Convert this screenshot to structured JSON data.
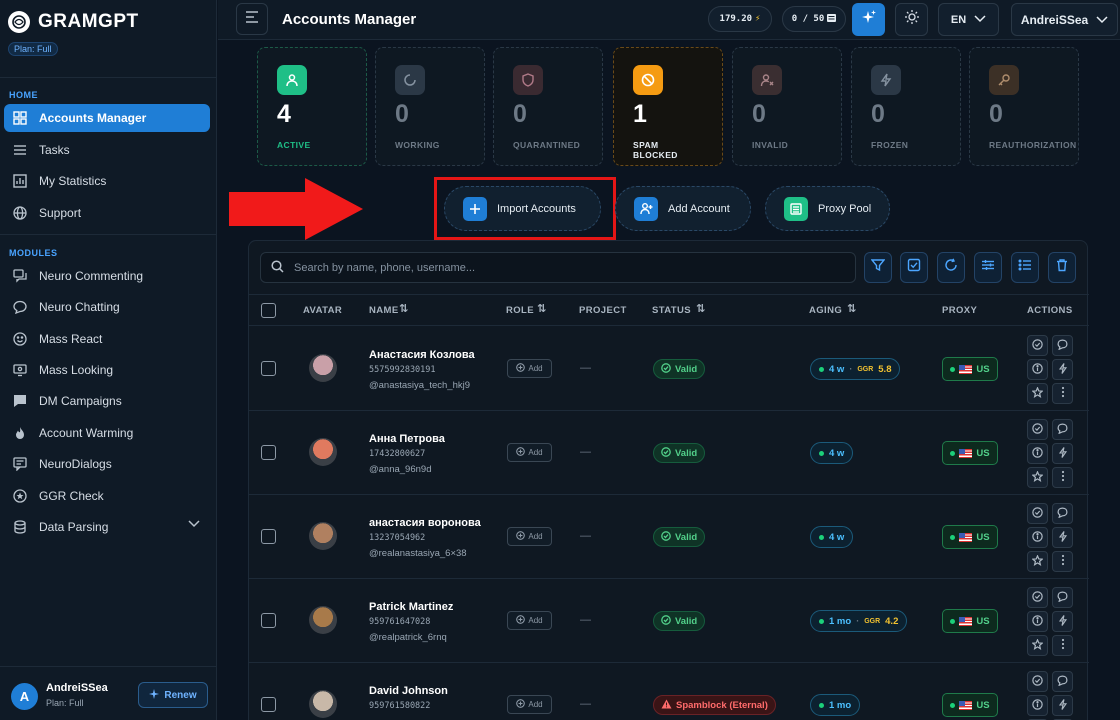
{
  "app": {
    "name": "GRAMGPT",
    "plan_badge": "Plan: Full"
  },
  "sidebar": {
    "sections": [
      {
        "label": "HOME",
        "items": [
          {
            "label": "Accounts Manager",
            "icon": "grid-icon",
            "active": true
          },
          {
            "label": "Tasks",
            "icon": "list-icon"
          },
          {
            "label": "My Statistics",
            "icon": "chart-icon"
          },
          {
            "label": "Support",
            "icon": "globe-icon"
          }
        ]
      },
      {
        "label": "MODULES",
        "items": [
          {
            "label": "Neuro Commenting",
            "icon": "comments-icon"
          },
          {
            "label": "Neuro Chatting",
            "icon": "chat-icon"
          },
          {
            "label": "Mass React",
            "icon": "smile-icon"
          },
          {
            "label": "Mass Looking",
            "icon": "monitor-icon"
          },
          {
            "label": "DM Campaigns",
            "icon": "message-icon"
          },
          {
            "label": "Account Warming",
            "icon": "flame-icon"
          },
          {
            "label": "NeuroDialogs",
            "icon": "dialogs-icon"
          },
          {
            "label": "GGR Check",
            "icon": "star-badge-icon"
          },
          {
            "label": "Data Parsing",
            "icon": "database-icon",
            "expandable": true
          }
        ]
      }
    ],
    "user": {
      "initial": "A",
      "name": "AndreiSSea",
      "plan": "Plan: Full",
      "renew_label": "Renew"
    }
  },
  "header": {
    "title": "Accounts Manager",
    "balance": "179.20",
    "quota": "0 / 50",
    "language": "EN",
    "username": "AndreiSSea"
  },
  "stats": [
    {
      "value": "4",
      "label": "ACTIVE",
      "icon": "user-check-icon",
      "color": "#1fbf87"
    },
    {
      "value": "0",
      "label": "WORKING",
      "icon": "loading-icon",
      "color": "#5b6977"
    },
    {
      "value": "0",
      "label": "QUARANTINED",
      "icon": "shield-icon",
      "color": "#8a5b66"
    },
    {
      "value": "1",
      "label": "SPAM BLOCKED",
      "icon": "ban-icon",
      "color": "#f59b12"
    },
    {
      "value": "0",
      "label": "INVALID",
      "icon": "user-x-icon",
      "color": "#7d5f62"
    },
    {
      "value": "0",
      "label": "FROZEN",
      "icon": "bolt-icon",
      "color": "#5b6977"
    },
    {
      "value": "0",
      "label": "REAUTHORIZATION",
      "icon": "key-icon",
      "color": "#7c6552"
    }
  ],
  "actions": {
    "import_label": "Import Accounts",
    "add_label": "Add Account",
    "proxy_label": "Proxy Pool"
  },
  "table": {
    "search_placeholder": "Search by name, phone, username...",
    "columns": [
      "AVATAR",
      "NAME",
      "ROLE",
      "PROJECT",
      "STATUS",
      "AGING",
      "PROXY",
      "ACTIONS"
    ],
    "add_role_label": "Add",
    "empty_project": "—",
    "ggr_label": "GGR",
    "rows": [
      {
        "name": "Анастасия Козлова",
        "phone": "5575992830191",
        "username": "@anastasiya_tech_hkj9",
        "status": "Valid",
        "status_type": "valid",
        "aging": "4 w",
        "ggr": "5.8",
        "proxy": "US",
        "avatar_color": "#c9a0a8"
      },
      {
        "name": "Анна Петрова",
        "phone": "17432800627",
        "username": "@anna_96n9d",
        "status": "Valid",
        "status_type": "valid",
        "aging": "4 w",
        "ggr": "",
        "proxy": "US",
        "avatar_color": "#e07a5f"
      },
      {
        "name": "анастасия воронова",
        "phone": "13237054962",
        "username": "@realanastasiya_6×38",
        "status": "Valid",
        "status_type": "valid",
        "aging": "4 w",
        "ggr": "",
        "proxy": "US",
        "avatar_color": "#b08060"
      },
      {
        "name": "Patrick Martinez",
        "phone": "959761647028",
        "username": "@realpatrick_6rnq",
        "status": "Valid",
        "status_type": "valid",
        "aging": "1 mo",
        "ggr": "4.2",
        "proxy": "US",
        "avatar_color": "#a87a4a"
      },
      {
        "name": "David Johnson",
        "phone": "959761580822",
        "username": "",
        "status": "Spamblock (Eternal)",
        "status_type": "spam",
        "aging": "1 mo",
        "ggr": "",
        "proxy": "US",
        "avatar_color": "#c8b8a8"
      }
    ]
  }
}
